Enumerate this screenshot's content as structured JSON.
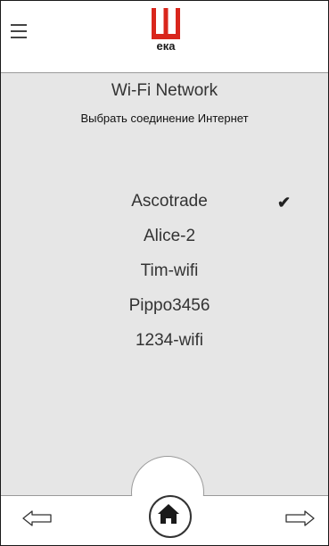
{
  "header": {
    "menu_icon": "hamburger-menu-icon",
    "logo_text": "ека"
  },
  "screen": {
    "title": "Wi-Fi Network",
    "subtitle": "Выбрать соединение Интернет"
  },
  "networks": [
    {
      "name": "Ascotrade",
      "selected": true
    },
    {
      "name": "Alice-2",
      "selected": false
    },
    {
      "name": "Tim-wifi",
      "selected": false
    },
    {
      "name": "Pippo3456",
      "selected": false
    },
    {
      "name": "1234-wifi",
      "selected": false
    }
  ],
  "selected_mark": "✔",
  "footer": {
    "back_icon": "arrow-left-icon",
    "home_icon": "home-icon",
    "next_icon": "arrow-right-icon"
  },
  "colors": {
    "brand_red": "#d9261c",
    "background": "#e6e6e6",
    "header": "#ffffff"
  }
}
